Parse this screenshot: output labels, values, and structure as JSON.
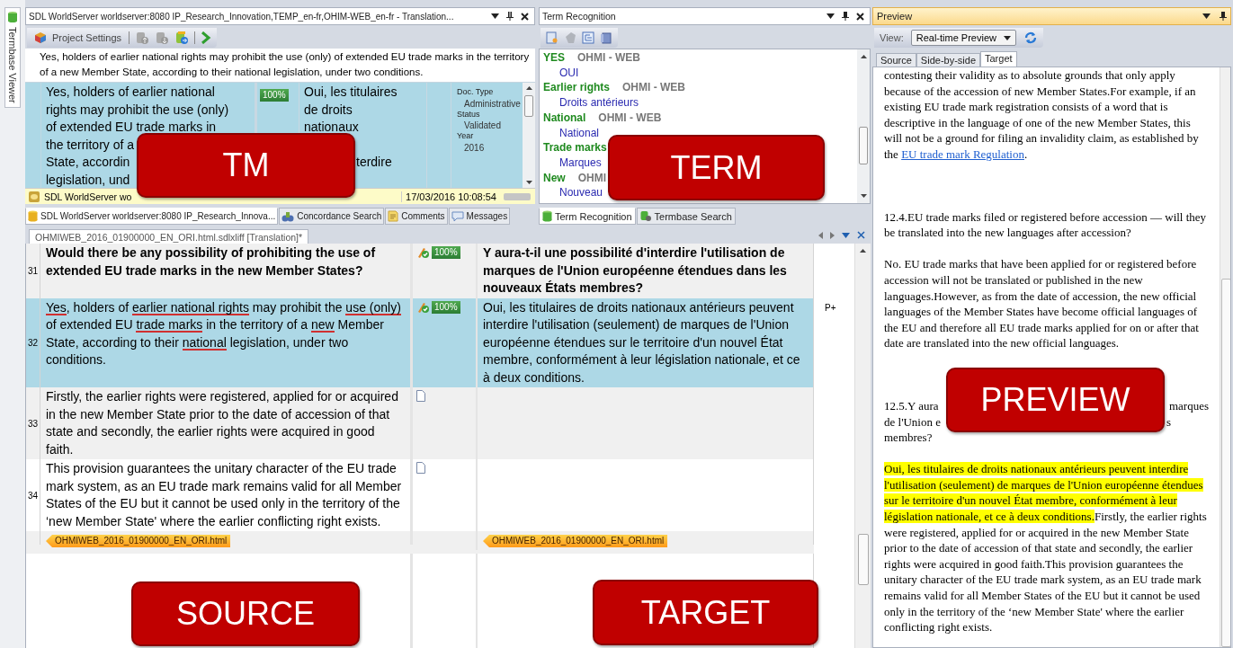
{
  "side_tab": {
    "label": "Termbase Viewer"
  },
  "tm_panel": {
    "title": "SDL WorldServer worldserver:8080 IP_Research_Innovation,TEMP_en-fr,OHIM-WEB_en-fr - Translation...",
    "toolbar_button": "Project Settings",
    "active_segment": "Yes, holders of earlier national rights may prohibit the use (only) of extended EU trade marks in the territory of a new Member State, according to their national legislation, under two conditions.",
    "match": {
      "source_lines": [
        "Yes, holders of earlier national",
        "rights may prohibit the use (only)",
        "of extended EU trade marks in",
        "the territory of a",
        "State, accordin",
        "legislation, und"
      ],
      "score": "100%",
      "target_lines": [
        "Oui, les titulaires",
        "de droits",
        "nationaux"
      ],
      "target_tail": "terdire",
      "fields": [
        {
          "label": "Doc. Type",
          "value": "Administrative"
        },
        {
          "label": "Status",
          "value": "Validated"
        },
        {
          "label": "Year",
          "value": "2016"
        }
      ]
    },
    "status_bar": {
      "origin": "SDL WorldServer wo",
      "date": "17/03/2016 10:08:54"
    },
    "tabs": [
      {
        "label": "SDL WorldServer worldserver:8080 IP_Research_Innova...",
        "selected": true
      },
      {
        "label": "Concordance Search",
        "selected": false
      },
      {
        "label": "Comments",
        "selected": false
      },
      {
        "label": "Messages",
        "selected": false
      }
    ]
  },
  "term_panel": {
    "title": "Term Recognition",
    "terms": [
      {
        "term": "YES",
        "source": "OHMI - WEB",
        "translation": "OUI"
      },
      {
        "term": "Earlier rights",
        "source": "OHMI - WEB",
        "translation": "Droits antérieurs"
      },
      {
        "term": "National",
        "source": "OHMI - WEB",
        "translation": "National"
      },
      {
        "term": "Trade marks",
        "translation": "Marques"
      },
      {
        "term": "New",
        "source": "OHMI",
        "translation": "Nouveau"
      }
    ],
    "tabs": [
      {
        "label": "Term Recognition",
        "selected": true
      },
      {
        "label": "Termbase Search",
        "selected": false
      }
    ]
  },
  "editor": {
    "document_tab": {
      "label": "OHMIWEB_2016_01900000_EN_ORI.html.sdlxliff [Translation]*",
      "selected": true
    },
    "rows": [
      {
        "number": "31",
        "kind": "confirmed",
        "heading": true,
        "selected": false,
        "source": "Would there be any possibility of prohibiting the use of extended EU trade marks in the new Member States?",
        "score": "100%",
        "target": "Y aura-t-il une possibilité d'interdire l'utilisation de marques de l'Union européenne étendues dans les nouveaux États membres?"
      },
      {
        "number": "32",
        "kind": "confirmed",
        "heading": false,
        "selected": true,
        "source_parts": [
          {
            "text": "Yes",
            "flagged": true
          },
          {
            "text": ", holders of ",
            "flagged": false
          },
          {
            "text": "earlier national rights",
            "flagged": true
          },
          {
            "text": " may prohibit the ",
            "flagged": false
          },
          {
            "text": "use (only)",
            "flagged": true
          },
          {
            "text": " of extended EU ",
            "flagged": false
          },
          {
            "text": "trade marks",
            "flagged": true
          },
          {
            "text": " in the territory of a ",
            "flagged": false
          },
          {
            "text": "new",
            "flagged": true
          },
          {
            "text": " Member State, according to their ",
            "flagged": false
          },
          {
            "text": "national",
            "flagged": true
          },
          {
            "text": " legislation, under two conditions.",
            "flagged": false
          }
        ],
        "score": "100%",
        "target": "Oui, les titulaires de droits nationaux antérieurs peuvent interdire l'utilisation (seulement) de marques de l'Union européenne étendues sur le territoire d'un nouvel État membre, conformément à leur législation nationale, et ce à deux conditions.",
        "flag": "P+"
      },
      {
        "number": "33",
        "kind": "new",
        "heading": false,
        "selected": false,
        "source": "Firstly, the earlier rights were registered, applied for or acquired in the new Member State prior to the date of accession of that state and secondly, the earlier rights were acquired in good faith."
      },
      {
        "number": "34",
        "kind": "new",
        "heading": false,
        "selected": false,
        "source": "This provision guarantees the unitary character of the EU trade mark system, as an EU trade mark remains valid for all Member States of the EU but it cannot be used only in the territory of the ‘new Member State' where the earlier conflicting right exists."
      }
    ],
    "tags": {
      "source": "OHMIWEB_2016_01900000_EN_ORI.html",
      "target": "OHMIWEB_2016_01900000_EN_ORI.html"
    }
  },
  "preview": {
    "title": "Preview",
    "view_label": "View:",
    "view_value": "Real-time Preview",
    "tabs": [
      {
        "label": "Source",
        "selected": false
      },
      {
        "label": "Side-by-side",
        "selected": false
      },
      {
        "label": "Target",
        "selected": true
      }
    ],
    "blocks": [
      {
        "kind": "text",
        "text": "contesting their validity as to absolute grounds that only apply because of the accession of new Member States.For example, if an existing EU trade mark registration consists of a word that is descriptive in the language of one of the new Member States, this will not be a ground for filing an invalidity claim, as established by the ",
        "link": "EU trade mark Regulation",
        "after": "."
      },
      {
        "kind": "heading",
        "text": "12.4.EU trade marks filed or registered before accession — will they be translated into the new languages after accession?"
      },
      {
        "kind": "text",
        "text": "No. EU trade marks that have been applied for or registered before accession will not be translated or published in the new languages.However, as from the date of accession, the new official languages of the Member States have become official languages of the EU and therefore all EU trade marks applied for on or after that date are translated into the new official languages."
      },
      {
        "kind": "covered",
        "lines": [
          [
            "12.5.Y aura",
            "marques"
          ],
          [
            "de l'Union e",
            "s"
          ],
          [
            "membres?"
          ]
        ]
      },
      {
        "kind": "highlighted",
        "highlight": "Oui, les titulaires de droits nationaux antérieurs peuvent interdire l'utilisation (seulement) de marques de l'Union européenne étendues sur le territoire d'un nouvel État membre, conformément à leur législation nationale, et ce à deux conditions.",
        "text": "Firstly, the earlier rights were registered, applied for or acquired in the new Member State prior to the date of accession of that state and secondly, the earlier rights were acquired in good faith.This provision guarantees the unitary character of the EU trade mark system, as an EU trade mark remains valid for all Member States of the EU but it cannot be used only in the territory of the ‘new Member State' where the earlier conflicting right exists."
      }
    ]
  },
  "callouts": [
    {
      "label": "TM"
    },
    {
      "label": "TERM"
    },
    {
      "label": "SOURCE"
    },
    {
      "label": "TARGET"
    },
    {
      "label": "PREVIEW"
    }
  ]
}
